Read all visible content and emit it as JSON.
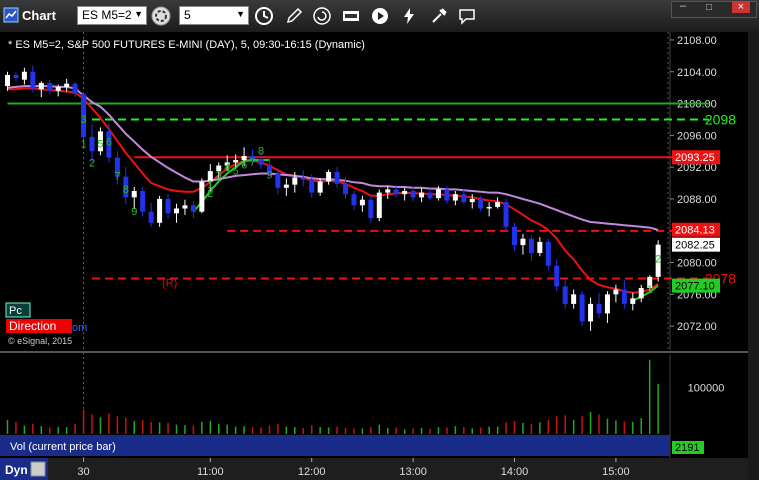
{
  "window": {
    "title": "Chart",
    "symbol_value": "ES M5=2",
    "interval_value": "5"
  },
  "toolbar_icons": [
    "search-icon",
    "refresh-settings-icon",
    "clock-icon",
    "pencil-icon",
    "refresh-icon",
    "quote-icon",
    "play-icon",
    "lightning-icon",
    "settings-icon",
    "comment-icon"
  ],
  "chart_data": {
    "type": "candlestick",
    "title": "* ES M5=2, S&P 500 FUTURES E-MINI (DAY), 5, 09:30-16:15 (Dynamic)",
    "price_axis": {
      "range": [
        2069.0,
        2109.0
      ],
      "ticks": [
        "2108.00",
        "2104.00",
        "2100.00",
        "2096.00",
        "2092.00",
        "2088.00",
        "2084.00",
        "2080.00",
        "2076.00",
        "2072.00"
      ]
    },
    "time_axis": {
      "labels": [
        {
          "label": "30",
          "bar": 9
        },
        {
          "label": "11:00",
          "bar": 24
        },
        {
          "label": "12:00",
          "bar": 36
        },
        {
          "label": "13:00",
          "bar": 48
        },
        {
          "label": "14:00",
          "bar": 60
        },
        {
          "label": "15:00",
          "bar": 72
        }
      ]
    },
    "price_labels": [
      {
        "text": "2093.25",
        "price": 2093.25,
        "bg": "#ee1111",
        "color": "#ffffff"
      },
      {
        "text": "2084.13",
        "price": 2084.13,
        "bg": "#ee1111",
        "color": "#ffffff"
      },
      {
        "text": "2082.25",
        "price": 2082.25,
        "bg": "#ffffff",
        "color": "#000000"
      },
      {
        "text": "2077.10",
        "price": 2077.1,
        "bg": "#22cc22",
        "color": "#000000"
      }
    ],
    "level_lines": [
      {
        "price": 2100.0,
        "color": "#22aa22",
        "style": "solid",
        "from_bar": 0,
        "to_bar": 83,
        "label": ""
      },
      {
        "price": 2098.0,
        "color": "#22ee22",
        "style": "dashed",
        "from_bar": 10,
        "to_bar": 83,
        "label": "2098"
      },
      {
        "price": 2093.25,
        "color": "#ee1111",
        "style": "solid",
        "from_bar": 15,
        "to_bar": 83,
        "label": ""
      },
      {
        "price": 2083.98,
        "color": "#ee1111",
        "style": "dashed",
        "from_bar": 26,
        "to_bar": 83,
        "label": ""
      },
      {
        "price": 2078.0,
        "color": "#ee1111",
        "style": "dashed",
        "from_bar": 10,
        "to_bar": 83,
        "label": "2078"
      }
    ],
    "bars": [
      [
        2102.2,
        2104.0,
        2101.6,
        2103.6
      ],
      [
        2103.6,
        2103.9,
        2102.8,
        2103.2
      ],
      [
        2103.0,
        2104.5,
        2102.4,
        2104.0
      ],
      [
        2104.0,
        2104.8,
        2101.4,
        2101.9
      ],
      [
        2101.8,
        2102.8,
        2100.8,
        2102.6
      ],
      [
        2102.6,
        2103.0,
        2101.2,
        2101.6
      ],
      [
        2101.6,
        2102.4,
        2100.9,
        2102.1
      ],
      [
        2102.1,
        2103.1,
        2101.5,
        2102.5
      ],
      [
        2102.5,
        2102.7,
        2100.8,
        2101.2
      ],
      [
        2101.2,
        2101.3,
        2095.0,
        2095.8
      ],
      [
        2095.8,
        2097.4,
        2092.6,
        2094.0
      ],
      [
        2094.0,
        2097.0,
        2093.5,
        2096.5
      ],
      [
        2096.5,
        2097.5,
        2092.6,
        2093.2
      ],
      [
        2093.2,
        2094.0,
        2089.8,
        2090.8
      ],
      [
        2090.8,
        2092.0,
        2087.4,
        2088.2
      ],
      [
        2088.2,
        2089.5,
        2086.7,
        2089.0
      ],
      [
        2089.0,
        2089.5,
        2085.8,
        2086.4
      ],
      [
        2086.4,
        2087.5,
        2084.5,
        2085.0
      ],
      [
        2085.0,
        2088.4,
        2084.5,
        2088.0
      ],
      [
        2088.0,
        2088.6,
        2085.5,
        2086.2
      ],
      [
        2086.2,
        2087.4,
        2085.0,
        2086.8
      ],
      [
        2086.8,
        2087.9,
        2086.0,
        2087.2
      ],
      [
        2087.2,
        2087.8,
        2085.6,
        2086.4
      ],
      [
        2086.4,
        2090.6,
        2086.2,
        2090.2
      ],
      [
        2090.2,
        2092.4,
        2089.0,
        2091.5
      ],
      [
        2091.5,
        2092.6,
        2090.6,
        2092.2
      ],
      [
        2092.2,
        2093.5,
        2091.5,
        2092.6
      ],
      [
        2092.6,
        2093.6,
        2091.8,
        2092.9
      ],
      [
        2092.9,
        2094.5,
        2092.1,
        2093.4
      ],
      [
        2093.4,
        2094.2,
        2092.4,
        2093.0
      ],
      [
        2093.0,
        2093.9,
        2091.8,
        2092.3
      ],
      [
        2092.3,
        2093.2,
        2090.8,
        2091.2
      ],
      [
        2091.2,
        2091.8,
        2088.6,
        2089.4
      ],
      [
        2089.4,
        2090.6,
        2088.4,
        2089.8
      ],
      [
        2089.8,
        2091.4,
        2088.8,
        2090.7
      ],
      [
        2090.7,
        2091.6,
        2089.6,
        2090.4
      ],
      [
        2090.4,
        2091.1,
        2088.2,
        2088.8
      ],
      [
        2088.8,
        2090.6,
        2088.4,
        2090.2
      ],
      [
        2090.2,
        2091.7,
        2089.8,
        2091.4
      ],
      [
        2091.4,
        2092.0,
        2089.4,
        2089.9
      ],
      [
        2089.9,
        2090.8,
        2088.0,
        2088.6
      ],
      [
        2088.6,
        2089.0,
        2086.6,
        2087.2
      ],
      [
        2087.2,
        2088.4,
        2086.4,
        2087.9
      ],
      [
        2087.9,
        2088.4,
        2085.0,
        2085.6
      ],
      [
        2085.6,
        2089.2,
        2085.2,
        2088.8
      ],
      [
        2088.8,
        2089.6,
        2088.0,
        2089.2
      ],
      [
        2089.2,
        2089.8,
        2088.2,
        2088.6
      ],
      [
        2088.6,
        2089.4,
        2087.8,
        2089.0
      ],
      [
        2089.0,
        2089.6,
        2087.7,
        2088.2
      ],
      [
        2088.2,
        2089.4,
        2087.6,
        2088.8
      ],
      [
        2088.8,
        2089.3,
        2087.8,
        2088.1
      ],
      [
        2088.1,
        2089.6,
        2087.8,
        2089.2
      ],
      [
        2089.2,
        2089.6,
        2087.4,
        2087.8
      ],
      [
        2087.8,
        2089.0,
        2087.2,
        2088.6
      ],
      [
        2088.6,
        2089.2,
        2087.4,
        2087.6
      ],
      [
        2087.6,
        2088.6,
        2086.8,
        2088.0
      ],
      [
        2088.0,
        2088.4,
        2086.4,
        2086.8
      ],
      [
        2086.8,
        2087.6,
        2085.8,
        2087.0
      ],
      [
        2087.0,
        2088.2,
        2086.8,
        2087.6
      ],
      [
        2087.6,
        2088.0,
        2083.9,
        2084.5
      ],
      [
        2084.5,
        2085.0,
        2081.5,
        2082.2
      ],
      [
        2082.2,
        2083.6,
        2081.0,
        2083.0
      ],
      [
        2083.0,
        2083.4,
        2080.2,
        2081.2
      ],
      [
        2081.2,
        2083.2,
        2080.8,
        2082.6
      ],
      [
        2082.6,
        2083.0,
        2079.0,
        2079.6
      ],
      [
        2079.6,
        2080.4,
        2076.4,
        2077.0
      ],
      [
        2077.0,
        2077.8,
        2074.2,
        2074.8
      ],
      [
        2074.8,
        2076.6,
        2074.2,
        2076.0
      ],
      [
        2076.0,
        2076.4,
        2072.0,
        2072.6
      ],
      [
        2072.6,
        2075.6,
        2071.4,
        2074.8
      ],
      [
        2074.8,
        2076.2,
        2073.0,
        2073.6
      ],
      [
        2073.6,
        2076.4,
        2072.4,
        2076.0
      ],
      [
        2076.0,
        2077.2,
        2075.0,
        2076.6
      ],
      [
        2076.6,
        2077.8,
        2074.2,
        2074.8
      ],
      [
        2074.8,
        2076.2,
        2074.0,
        2075.5
      ],
      [
        2075.5,
        2077.2,
        2075.0,
        2076.8
      ],
      [
        2076.8,
        2078.4,
        2076.4,
        2078.2
      ],
      [
        2078.2,
        2082.8,
        2077.6,
        2082.25
      ]
    ],
    "series": [
      {
        "name": "",
        "color": "#ee1111",
        "values": [
          2101.8,
          2101.8,
          2101.9,
          2101.9,
          2101.8,
          2101.7,
          2101.6,
          2101.5,
          2101.4,
          2100.6,
          2099.4,
          2098.2,
          2096.8,
          2095.3,
          2093.8,
          2092.5,
          2091.2,
          2090.0,
          2089.6,
          2089.2,
          2089.0,
          2088.9,
          2088.9,
          2089.4,
          2090.1,
          2091.0,
          2091.8,
          2092.4,
          2092.8,
          2092.8,
          2092.6,
          2092.2,
          2091.6,
          2091.1,
          2090.9,
          2090.7,
          2090.3,
          2090.2,
          2090.3,
          2090.2,
          2089.9,
          2089.4,
          2089.0,
          2088.4,
          2088.4,
          2088.6,
          2088.7,
          2088.8,
          2088.7,
          2088.7,
          2088.6,
          2088.6,
          2088.5,
          2088.4,
          2088.3,
          2088.2,
          2088.0,
          2087.8,
          2087.7,
          2087.3,
          2086.7,
          2086.0,
          2085.3,
          2084.8,
          2084.1,
          2083.0,
          2081.5,
          2080.4,
          2079.0,
          2077.8,
          2077.2,
          2076.9,
          2076.7,
          2076.4,
          2076.2,
          2076.3,
          2076.6,
          2077.3
        ]
      },
      {
        "name": "",
        "color": "#22cc22",
        "values": [
          null,
          null,
          null,
          null,
          null,
          null,
          null,
          null,
          null,
          null,
          null,
          null,
          null,
          null,
          null,
          null,
          null,
          null,
          null,
          null,
          null,
          null,
          2086.4,
          2087.6,
          2089.0,
          2090.2,
          2091.2,
          2092.0,
          2092.8,
          2092.9,
          2092.9,
          2092.9,
          null,
          null,
          null,
          null,
          null,
          null,
          null,
          null,
          null,
          null,
          null,
          null,
          null,
          null,
          null,
          null,
          null,
          null,
          null,
          null,
          null,
          null,
          null,
          null,
          null,
          null,
          null,
          null,
          null,
          null,
          null,
          null,
          null,
          null,
          null,
          null,
          null,
          null,
          null,
          null,
          null,
          null,
          2075.2,
          2075.7,
          2076.3,
          2077.1
        ]
      },
      {
        "name": "",
        "color": "#c08adf",
        "values": [
          2102.0,
          2102.1,
          2102.2,
          2102.2,
          2102.2,
          2102.2,
          2102.1,
          2102.1,
          2101.9,
          2101.0,
          2100.2,
          2099.6,
          2098.6,
          2097.4,
          2096.2,
          2095.2,
          2094.2,
          2093.3,
          2092.6,
          2091.9,
          2091.3,
          2090.7,
          2090.2,
          2090.2,
          2090.3,
          2090.5,
          2090.7,
          2090.9,
          2091.0,
          2091.1,
          2091.2,
          2091.2,
          2091.1,
          2091.0,
          2090.9,
          2090.8,
          2090.6,
          2090.5,
          2090.5,
          2090.4,
          2090.3,
          2090.1,
          2090.0,
          2089.7,
          2089.6,
          2089.6,
          2089.5,
          2089.5,
          2089.4,
          2089.4,
          2089.3,
          2089.3,
          2089.2,
          2089.2,
          2089.1,
          2089.0,
          2088.9,
          2088.8,
          2088.8,
          2088.6,
          2088.3,
          2088.0,
          2087.7,
          2087.4,
          2087.0,
          2086.6,
          2086.2,
          2085.8,
          2085.4,
          2085.1,
          2085.0,
          2084.9,
          2084.8,
          2084.7,
          2084.6,
          2084.5,
          2084.4,
          2084.1
        ]
      }
    ],
    "bar_counts": [
      {
        "bar": 9,
        "text": "1",
        "dy": 8
      },
      {
        "bar": 10,
        "text": "2",
        "dy": 8
      },
      {
        "bar": 9,
        "text": "3",
        "dy": -30
      },
      {
        "bar": 11,
        "text": "5",
        "dy": -20
      },
      {
        "bar": 12,
        "text": "6",
        "dy": -22
      },
      {
        "bar": 13,
        "text": "7",
        "dy": -28
      },
      {
        "bar": 14,
        "text": "8",
        "dy": -26
      },
      {
        "bar": 15,
        "text": "9",
        "dy": -28
      },
      {
        "bar": 24,
        "text": "2",
        "dy": 6
      },
      {
        "bar": 25,
        "text": "3",
        "dy": 12
      },
      {
        "bar": 26,
        "text": "4",
        "dy": 12
      },
      {
        "bar": 27,
        "text": "5",
        "dy": 6
      },
      {
        "bar": 28,
        "text": "6",
        "dy": 10
      },
      {
        "bar": 29,
        "text": "7",
        "dy": 10
      },
      {
        "bar": 30,
        "text": "8",
        "dy": 26
      },
      {
        "bar": 31,
        "text": "9",
        "dy": 10
      },
      {
        "bar": 24,
        "text": "1",
        "dy": -24
      },
      {
        "bar": 76,
        "text": "1",
        "dy": 10
      },
      {
        "bar": 77,
        "text": "2",
        "dy": -22
      }
    ],
    "annotations": [
      {
        "text": "(R)",
        "bar": 19,
        "price": 2077.0,
        "color": "#cc1111"
      }
    ],
    "volume": {
      "label": "Vol (current price bar)",
      "tick": "100000",
      "last_value": "2191",
      "max": 170000,
      "values": [
        30000,
        26000,
        18000,
        22000,
        17000,
        14000,
        15000,
        15000,
        22000,
        52000,
        42000,
        36000,
        44000,
        38000,
        35000,
        28000,
        30000,
        26000,
        25000,
        24000,
        20000,
        19000,
        18000,
        26000,
        28000,
        22000,
        20000,
        16000,
        17000,
        15000,
        14000,
        18000,
        22000,
        16000,
        15000,
        13000,
        19000,
        15000,
        14000,
        16000,
        13000,
        12000,
        12000,
        15000,
        20000,
        13000,
        14000,
        10000,
        12000,
        13000,
        11000,
        15000,
        14000,
        17000,
        15000,
        12000,
        14000,
        16000,
        16000,
        25000,
        28000,
        24000,
        22000,
        25000,
        30000,
        38000,
        40000,
        30000,
        38000,
        47000,
        42000,
        33000,
        29000,
        27000,
        26000,
        34000,
        160000,
        108000
      ]
    },
    "left_badges": {
      "pc": "Pc",
      "direction": "Direction",
      "copyright": "© eSignal, 2015"
    },
    "bottom_bar": {
      "dyn": "Dyn"
    }
  }
}
